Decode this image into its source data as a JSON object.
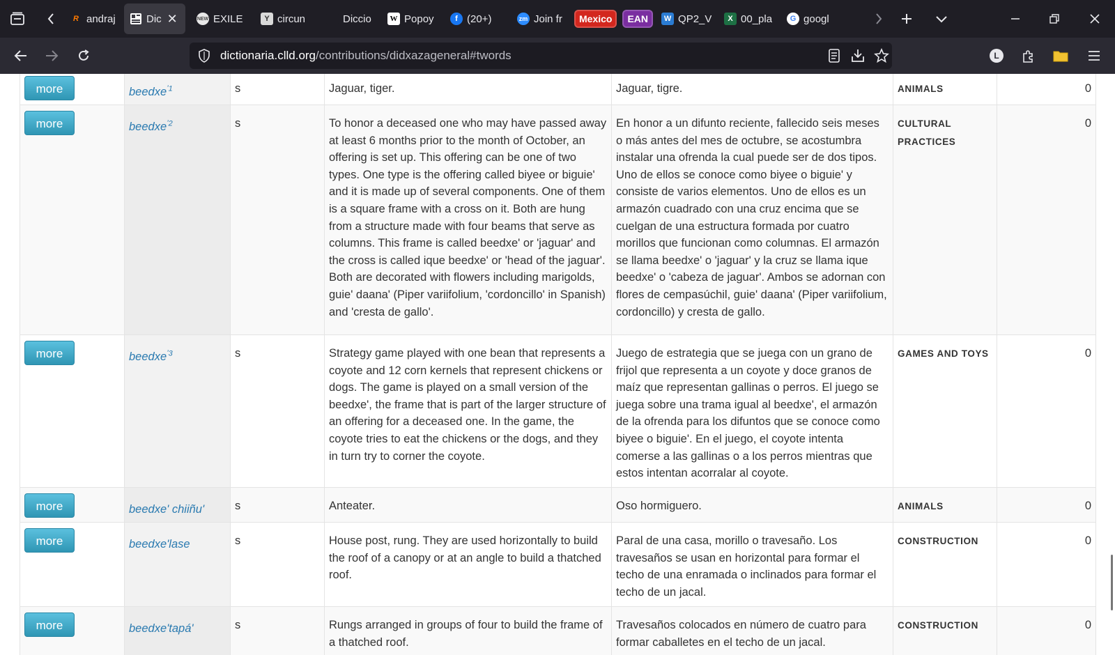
{
  "tabs": [
    {
      "label": "andraj",
      "favicon": "R",
      "fav_color": "#ff7a00"
    },
    {
      "label": "Dic",
      "favicon": "grid",
      "fav_color": "#ffffff",
      "active": true
    },
    {
      "label": "EXILE",
      "favicon": "NEW",
      "fav_color": "#bbbbbb"
    },
    {
      "label": "circun",
      "favicon": "doc",
      "fav_color": "#dddddd"
    },
    {
      "label": "Diccio",
      "favicon": "",
      "fav_color": "#1f1e25"
    },
    {
      "label": "Popoy",
      "favicon": "W",
      "fav_color": "#ffffff"
    },
    {
      "label": "(20+)",
      "favicon": "f",
      "fav_color": "#1877f2"
    },
    {
      "label": "Join fr",
      "favicon": "zm",
      "fav_color": "#2d8cff"
    },
    {
      "label": "QP2_V",
      "favicon": "W",
      "fav_color": "#2b7cd3"
    },
    {
      "label": "00_pla",
      "favicon": "X",
      "fav_color": "#1d7044"
    },
    {
      "label": "googl",
      "favicon": "G",
      "fav_color": "#ffffff"
    }
  ],
  "pinned_badges": [
    {
      "label": "Mexico",
      "bg": "#d3271e"
    },
    {
      "label": "EAN",
      "bg": "#7a2ea0"
    }
  ],
  "url": {
    "host": "dictionaria.clld.org",
    "path": "/contributions/didxazageneral#twords"
  },
  "rows": [
    {
      "more": "more",
      "headword": "beedxe",
      "sup": "1",
      "pos": "s",
      "en": "Jaguar, tiger.",
      "es": "Jaguar, tigre.",
      "domain": "ANIMALS",
      "count": "0"
    },
    {
      "more": "more",
      "headword": "beedxe",
      "sup": "2",
      "pos": "s",
      "en": "To honor a deceased one who may have passed away at least 6 months prior to the month of October, an offering is set up. This offering can be one of two types. One type is the offering called biyee or biguie' and it is made up of several components. One of them is a square frame with a cross on it. Both are hung from a structure made with four beams that serve as columns. This frame is called beedxe' or 'jaguar' and the cross is called ique beedxe' or 'head of the jaguar'. Both are decorated with flowers including marigolds, guie' daana' (Piper variifolium, 'cordoncillo' in Spanish) and 'cresta de gallo'.",
      "es": "En honor a un difunto reciente, fallecido seis meses o más antes del mes de octubre, se acostumbra instalar una ofrenda la cual puede ser de dos tipos. Uno de ellos se conoce como biyee o biguie' y consiste de varios elementos. Uno de ellos es un armazón cuadrado con una cruz encima que se cuelgan de una estructura formada por cuatro morillos que funcionan como columnas. El armazón se llama beedxe' o 'jaguar' y la cruz se llama ique beedxe' o 'cabeza de jaguar'. Ambos se adornan con flores de cempasúchil, guie' daana' (Piper variifolium, cordoncillo) y cresta de gallo.",
      "domain": "CULTURAL PRACTICES",
      "count": "0"
    },
    {
      "more": "more",
      "headword": "beedxe",
      "sup": "3",
      "pos": "s",
      "en": "Strategy game played with one bean that represents a coyote and 12 corn kernels that represent chickens or dogs. The game is played on a small version of the beedxe', the frame that is part of the larger structure of an offering for a deceased one. In the game, the coyote tries to eat the chickens or the dogs, and they in turn try to corner the coyote.",
      "es": "Juego de estrategia que se juega con un grano de frijol que representa a un coyote y doce granos de maíz que representan gallinas o perros. El juego se juega sobre una trama igual al beedxe', el armazón de la ofrenda para los difuntos que se conoce como biyee o biguie'. En el juego, el coyote intenta comerse a las gallinas o a los perros mientras que estos intentan acorralar al coyote.",
      "domain": "GAMES AND TOYS",
      "count": "0"
    },
    {
      "more": "more",
      "headword": "beedxe' chiiñu'",
      "sup": "",
      "pos": "s",
      "en": "Anteater.",
      "es": "Oso hormiguero.",
      "domain": "ANIMALS",
      "count": "0"
    },
    {
      "more": "more",
      "headword": "beedxe'lase",
      "sup": "",
      "pos": "s",
      "en": "House post, rung. They are used horizontally to build the roof of a canopy or at an angle to build a thatched roof.",
      "es": "Paral de una casa, morillo o travesaño. Los travesaños se usan en horizontal para formar el techo de una enramada o inclinados para formar el techo de un jacal.",
      "domain": "CONSTRUCTION",
      "count": "0"
    },
    {
      "more": "more",
      "headword": "beedxe'tapá'",
      "sup": "",
      "pos": "s",
      "en": "Rungs arranged in groups of four to build the frame of a thatched roof.",
      "es": "Travesaños colocados en número de cuatro para formar caballetes en el techo de un jacal.",
      "domain": "CONSTRUCTION",
      "count": "0"
    }
  ]
}
